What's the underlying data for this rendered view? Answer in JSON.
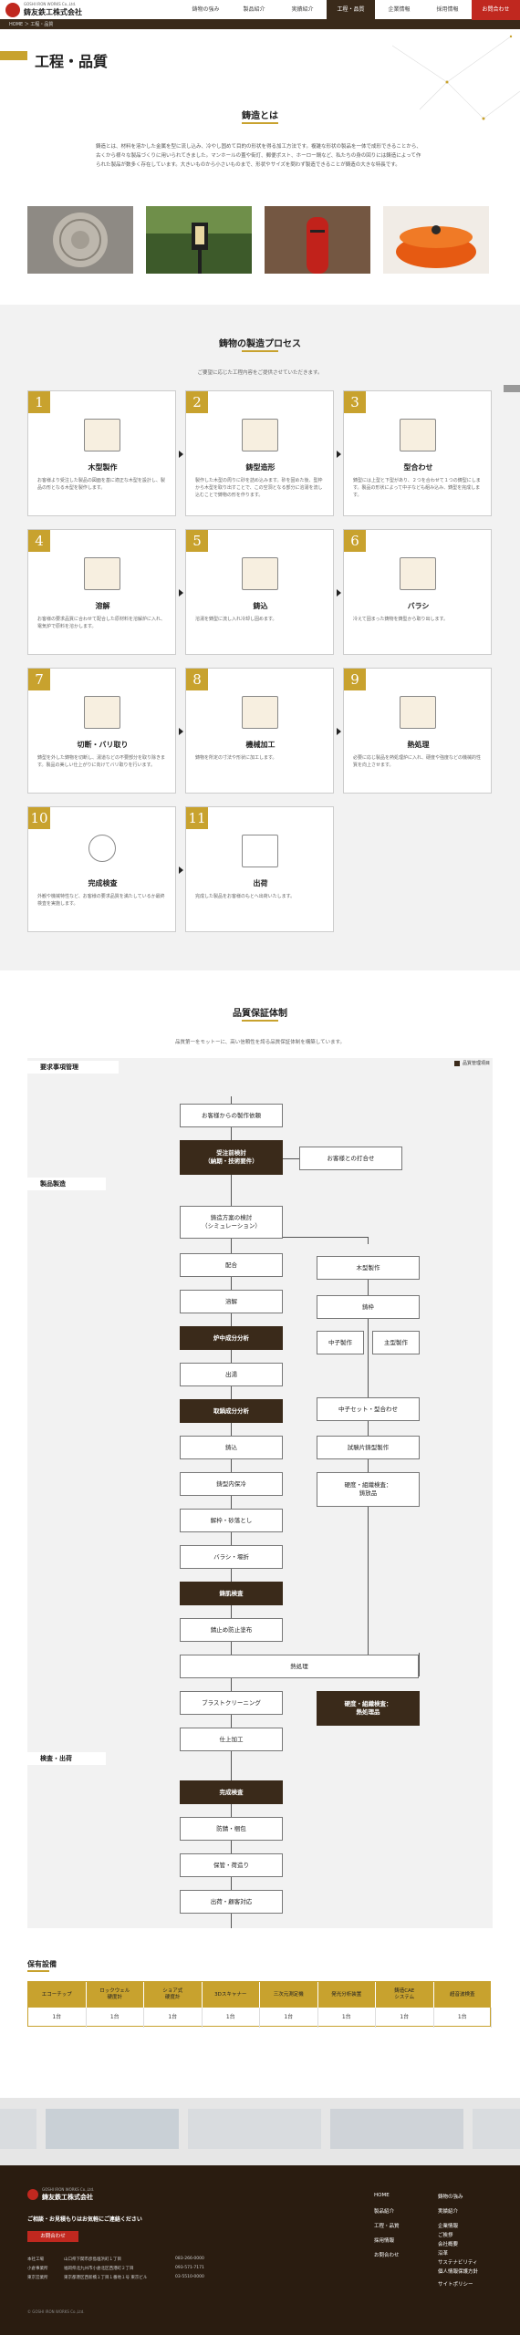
{
  "header": {
    "company_en": "GOSHI IRON WORKS Co.,Ltd.",
    "company": "鋳友鉄工株式会社",
    "nav": [
      "鋳物の強み",
      "製品紹介",
      "実績紹介",
      "工程・品質",
      "企業情報",
      "採用情報",
      "お問合わせ"
    ]
  },
  "breadcrumb": "HOME ＞ 工程・品質",
  "page_title": "工程・品質",
  "intro": {
    "heading": "鋳造とは",
    "text": "鋳造とは、材料を溶かした金属を型に流し込み、冷やし固めて目的の形状を得る加工方法です。複雑な形状の製品を一体で成形できることから、古くから様々な製品づくりに用いられてきました。マンホールの蓋や街灯、郵便ポスト、ホーロー鍋など、私たちの身の回りには鋳造によって作られた製品が数多く存在しています。大きいものから小さいものまで、形状やサイズを問わず製造できることが鋳造の大きな特長です。"
  },
  "process": {
    "heading": "鋳物の製造プロセス",
    "sub": "ご要望に応じた工程内容をご提供させていただきます。",
    "steps": [
      {
        "num": "1",
        "title": "木型製作",
        "desc": "お客様より受注した製品の図面を基に適正な木型を設計し、製品の形となる木型を製作します。"
      },
      {
        "num": "2",
        "title": "鋳型造形",
        "desc": "製作した木型の周りに砂を詰め込みます。砂を固めた後、型枠から木型を取り出すことで、この空洞となる部分に溶湯を流し込むことで鋳物の形を作ります。"
      },
      {
        "num": "3",
        "title": "型合わせ",
        "desc": "鋳型には上型と下型があり、２つを合わせて１つの鋳型にします。製品の形状によって中子なども組み込み、鋳型を完成します。"
      },
      {
        "num": "4",
        "title": "溶解",
        "desc": "お客様の要求品質に合わせて配合した原材料を溶解炉に入れ、電気炉で原料を溶かします。"
      },
      {
        "num": "5",
        "title": "鋳込",
        "desc": "溶湯を鋳型に流し入れ冷却し固めます。"
      },
      {
        "num": "6",
        "title": "バラシ",
        "desc": "冷えて固まった鋳物を鋳型から取り出します。"
      },
      {
        "num": "7",
        "title": "切断・バリ取り",
        "desc": "鋳型を外した鋳物を切断し、湯道などの不要部分を取り除きます。製品の美しい仕上がりに向けてバリ取りを行います。"
      },
      {
        "num": "8",
        "title": "機械加工",
        "desc": "鋳物を所定の寸法や形状に加工します。"
      },
      {
        "num": "9",
        "title": "熱処理",
        "desc": "必要に応じ製品を熱処理炉に入れ、硬度や強度などの機械的性質を向上させます。"
      },
      {
        "num": "10",
        "title": "完成検査",
        "desc": "外観や機械特性など、お客様の要求品質を満たしているか最終検査を実施します。"
      },
      {
        "num": "11",
        "title": "出荷",
        "desc": "完成した製品をお客様のもとへ出荷いたします。"
      }
    ]
  },
  "quality": {
    "heading": "品質保証体制",
    "sub": "品質第一をモットーに、高い信頼性を誇る品質保証体制を構築しています。",
    "legend": "品質管理項目",
    "sections": [
      "要求事項管理",
      "製品製造",
      "検査・出荷"
    ],
    "boxes": {
      "order": "お客様からの製作依頼",
      "review": "受注前検討\n（納期・技術要件）",
      "meeting": "お客様との打合せ",
      "plan": "鋳造方案の検討\n（シミュレーション）",
      "blend": "配合",
      "melt": "溶解",
      "furnace": "炉中成分分析",
      "tap": "出湯",
      "ladle": "取鍋成分分析",
      "pour": "鋳込",
      "temp": "鋳型内保冷",
      "dismantle": "解枠・砂落とし",
      "deburr": "バラシ・堰折",
      "casting_insp": "鋳肌検査",
      "rust": "錆止め防止塗布",
      "heat": "熱処理",
      "blast": "ブラストクリーニング",
      "finish": "仕上加工",
      "complete": "完成検査",
      "pack": "防錆・梱包",
      "storage": "保管・荷造り",
      "ship": "出荷・顧客対応",
      "pattern": "木型製作",
      "mold": "鋳枠",
      "core": "中子製作",
      "main_mold": "主型製作",
      "set": "中子セット・型合わせ",
      "trial": "試験片鋳型製作",
      "hard1": "硬度・組織検査：\n鋳放品",
      "hard2": "硬度・組織検査：\n熱処理品"
    }
  },
  "equipment": {
    "heading": "保有設備",
    "headers": [
      "エコーチップ",
      "ロックウェル\n硬度計",
      "ショア式\n硬度計",
      "3Dスキャナー",
      "三次元測定機",
      "発光分析装置",
      "鋳造CAE\nシステム",
      "超音波検査"
    ],
    "counts": [
      "1台",
      "1台",
      "1台",
      "1台",
      "1台",
      "1台",
      "1台",
      "1台"
    ]
  },
  "footer": {
    "company_en": "GOSHI IRON WORKS Co.,Ltd.",
    "company": "鋳友鉄工株式会社",
    "msg": "ご相談・お見積もりはお気軽にご連絡ください",
    "btn": "お問合わせ",
    "addr": [
      {
        "k": "本社工場",
        "v": "山口県下関市彦島塩浜町１丁目",
        "t": "083-266-0000"
      },
      {
        "k": "小倉事業所",
        "v": "福岡県北九州市小倉北区西港町２丁目",
        "t": "093-571-7171"
      },
      {
        "k": "東京営業所",
        "v": "東京都港区西新橋１丁目１番地１号 東京ビル",
        "t": "03-5510-0000"
      }
    ],
    "links1": [
      "HOME",
      "製品紹介",
      "工程・品質",
      "採用情報",
      "お問合わせ"
    ],
    "links2": [
      "鋳物の強み",
      "実績紹介",
      "企業情報",
      "ご挨拶",
      "会社概要",
      "沿革",
      "サステナビリティ",
      "個人情報保護方針",
      "サイトポリシー"
    ],
    "copy": "© GOSHI IRON WORKS Co.,Ltd."
  },
  "colors": {
    "brown": "#3a2a1a",
    "gold": "#c8a22e",
    "red": "#c0281f"
  }
}
